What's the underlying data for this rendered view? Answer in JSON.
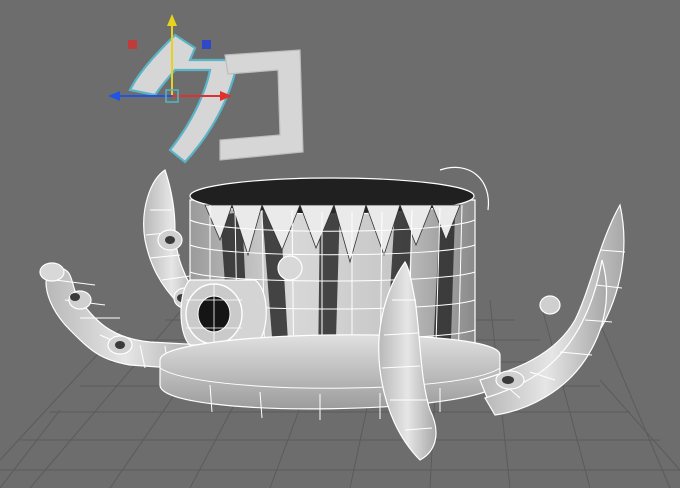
{
  "viewport": {
    "background": "#6d6d6d",
    "grid_color": "#5a5a5a",
    "wire_color": "#ffffff",
    "mesh_color": "#bdbdbd"
  },
  "text_objects": [
    {
      "text": "タ"
    },
    {
      "text": "コ"
    }
  ],
  "manipulator": {
    "x_axis_color": "#e0312c",
    "y_axis_color": "#e8d31c",
    "z_axis_color": "#1f55e0",
    "center_color": "#5ab4c8",
    "plane_xy_color": "#c23b3b",
    "plane_yz_color": "#2f48c9"
  },
  "model": {
    "name": "octopus-pot",
    "icons": [
      "cylinder-body",
      "spike-crown",
      "tentacle",
      "sucker",
      "eye-socket"
    ]
  }
}
